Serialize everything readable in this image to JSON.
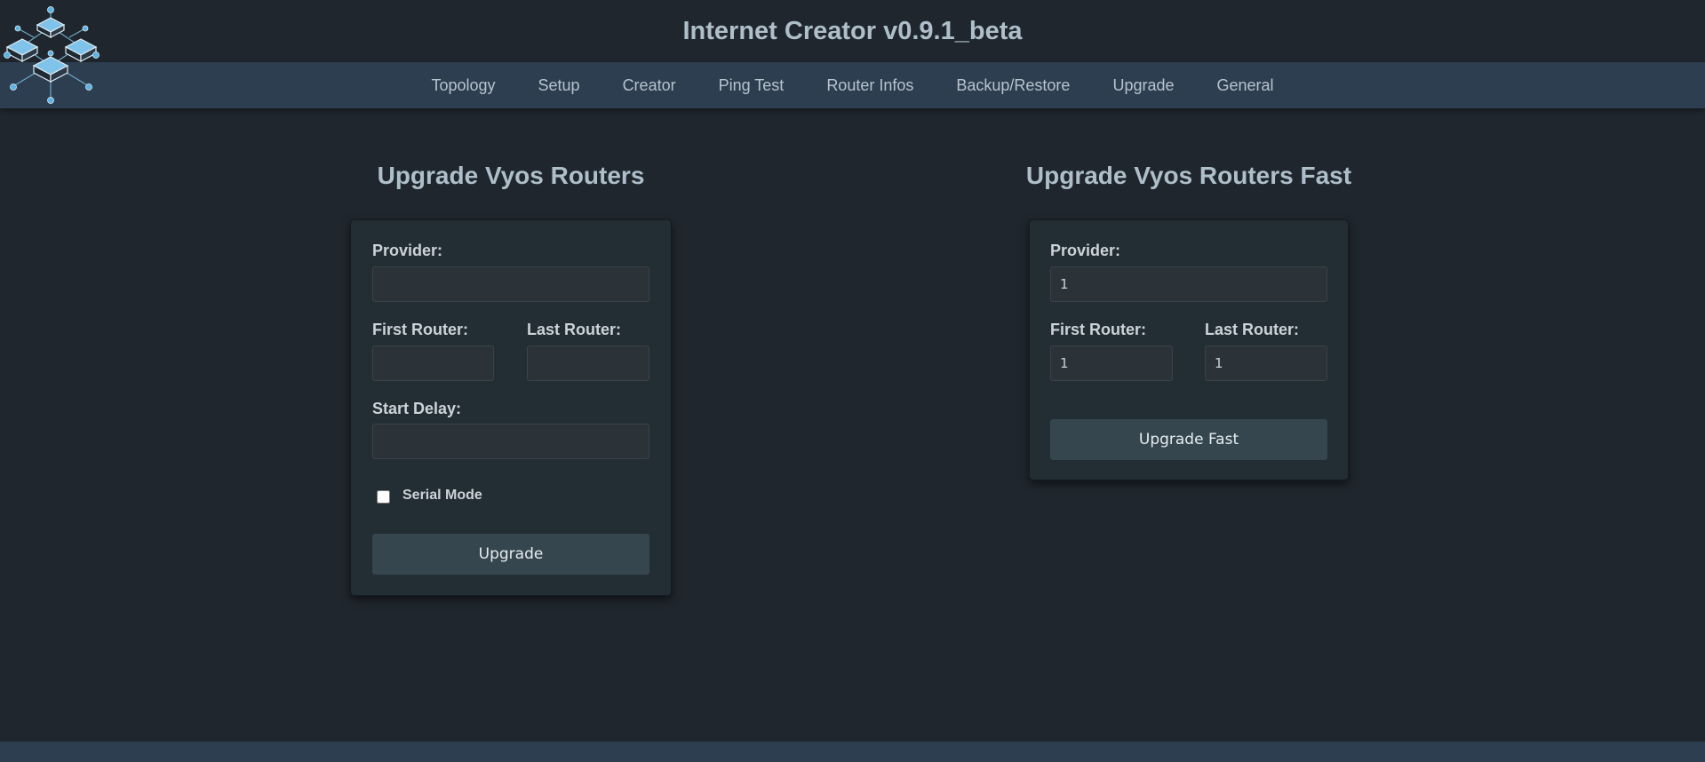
{
  "app": {
    "title": "Internet Creator v0.9.1_beta"
  },
  "nav": {
    "items": [
      {
        "label": "Topology"
      },
      {
        "label": "Setup"
      },
      {
        "label": "Creator"
      },
      {
        "label": "Ping Test"
      },
      {
        "label": "Router Infos"
      },
      {
        "label": "Backup/Restore"
      },
      {
        "label": "Upgrade"
      },
      {
        "label": "General"
      }
    ]
  },
  "upgrade": {
    "title": "Upgrade Vyos Routers",
    "provider_label": "Provider:",
    "provider_value": "",
    "first_router_label": "First Router:",
    "first_router_value": "",
    "last_router_label": "Last Router:",
    "last_router_value": "",
    "start_delay_label": "Start Delay:",
    "start_delay_value": "",
    "serial_mode_label": "Serial Mode",
    "button_label": "Upgrade"
  },
  "upgrade_fast": {
    "title": "Upgrade Vyos Routers Fast",
    "provider_label": "Provider:",
    "provider_value": "1",
    "first_router_label": "First Router:",
    "first_router_value": "1",
    "last_router_label": "Last Router:",
    "last_router_value": "1",
    "button_label": "Upgrade Fast"
  },
  "icons": {
    "logo": "network-routers-logo-icon"
  },
  "colors": {
    "background": "#1f262d",
    "navbar": "#2c3e50",
    "card": "#232d34",
    "button": "#36464f",
    "title_text": "#aebfca"
  }
}
